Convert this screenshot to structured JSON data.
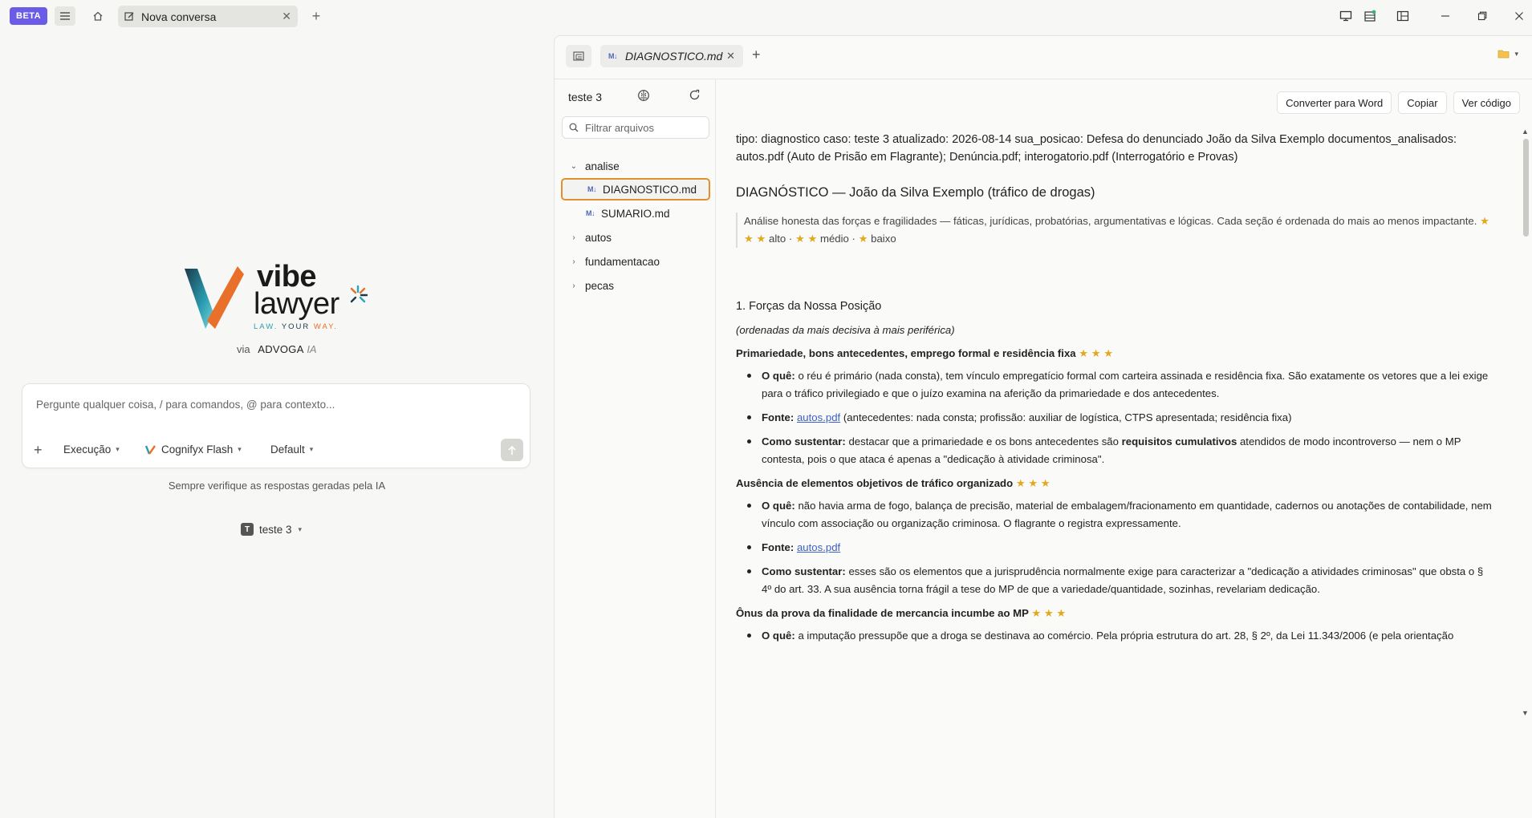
{
  "titlebar": {
    "beta": "BETA",
    "tab_label": "Nova conversa"
  },
  "left": {
    "logo_word1": "vibe",
    "logo_word2": "lawyer",
    "logo_tag_a": "LAW.",
    "logo_tag_b": "YOUR",
    "logo_tag_c": "WAY.",
    "via": "via",
    "advoga": "ADVOGA",
    "ia": "IA",
    "input_placeholder": "Pergunte qualquer coisa, / para comandos, @ para contexto...",
    "mode": "Execução",
    "model": "Cognifyx Flash",
    "profile": "Default",
    "disclaimer": "Sempre verifique as respostas geradas pela IA",
    "project_initial": "T",
    "project": "teste 3"
  },
  "right": {
    "tab_file": "DIAGNOSTICO.md",
    "tab_badge": "M↓",
    "tree": {
      "project": "teste 3",
      "filter_placeholder": "Filtrar arquivos",
      "folder_analise": "analise",
      "file_diag": "DIAGNOSTICO.md",
      "file_sumario": "SUMARIO.md",
      "folder_autos": "autos",
      "folder_fundamentacao": "fundamentacao",
      "folder_pecas": "pecas"
    },
    "toolbar": {
      "word": "Converter para Word",
      "copy": "Copiar",
      "code": "Ver código"
    }
  },
  "doc": {
    "frontmatter": "tipo: diagnostico caso: teste 3 atualizado: 2026-08-14 sua_posicao: Defesa do denunciado João da Silva Exemplo documentos_analisados: autos.pdf (Auto de Prisão em Flagrante); Denúncia.pdf; interogatorio.pdf (Interrogatório e Provas)",
    "title": "DIAGNÓSTICO — João da Silva Exemplo (tráfico de drogas)",
    "quote_text": "Análise honesta das forças e fragilidades — fáticas, jurídicas, probatórias, argumentativas e lógicas. Cada seção é ordenada do mais ao menos impactante.",
    "legend_high": "alto ·",
    "legend_mid": "médio ·",
    "legend_low": "baixo",
    "section1": "1. Forças da Nossa Posição",
    "section1_sub": "(ordenadas da mais decisiva à mais periférica)",
    "f1_title": "Primariedade, bons antecedentes, emprego formal e residência fixa",
    "f1_what_label": "O quê:",
    "f1_what": "o réu é primário (nada consta), tem vínculo empregatício formal com carteira assinada e residência fixa. São exatamente os vetores que a lei exige para o tráfico privilegiado e que o juízo examina na aferição da primariedade e dos antecedentes.",
    "f1_src_label": "Fonte:",
    "f1_src_link": "autos.pdf",
    "f1_src": "(antecedentes: nada consta; profissão: auxiliar de logística, CTPS apresentada; residência fixa)",
    "f1_how_label": "Como sustentar:",
    "f1_how_a": "destacar que a primariedade e os bons antecedentes são",
    "f1_how_bold": "requisitos cumulativos",
    "f1_how_b": "atendidos de modo incontroverso — nem o MP contesta, pois o que ataca é apenas a \"dedicação à atividade criminosa\".",
    "f2_title": "Ausência de elementos objetivos de tráfico organizado",
    "f2_what_label": "O quê:",
    "f2_what": "não havia arma de fogo, balança de precisão, material de embalagem/fracionamento em quantidade, cadernos ou anotações de contabilidade, nem vínculo com associação ou organização criminosa. O flagrante o registra expressamente.",
    "f2_src_label": "Fonte:",
    "f2_src_link": "autos.pdf",
    "f2_how_label": "Como sustentar:",
    "f2_how": "esses são os elementos que a jurisprudência normalmente exige para caracterizar a \"dedicação a atividades criminosas\" que obsta o § 4º do art. 33. A sua ausência torna frágil a tese do MP de que a variedade/quantidade, sozinhas, revelariam dedicação.",
    "f3_title": "Ônus da prova da finalidade de mercancia incumbe ao MP",
    "f3_what_label": "O quê:",
    "f3_what": "a imputação pressupõe que a droga se destinava ao comércio. Pela própria estrutura do art. 28, § 2º, da Lei 11.343/2006 (e pela orientação"
  }
}
